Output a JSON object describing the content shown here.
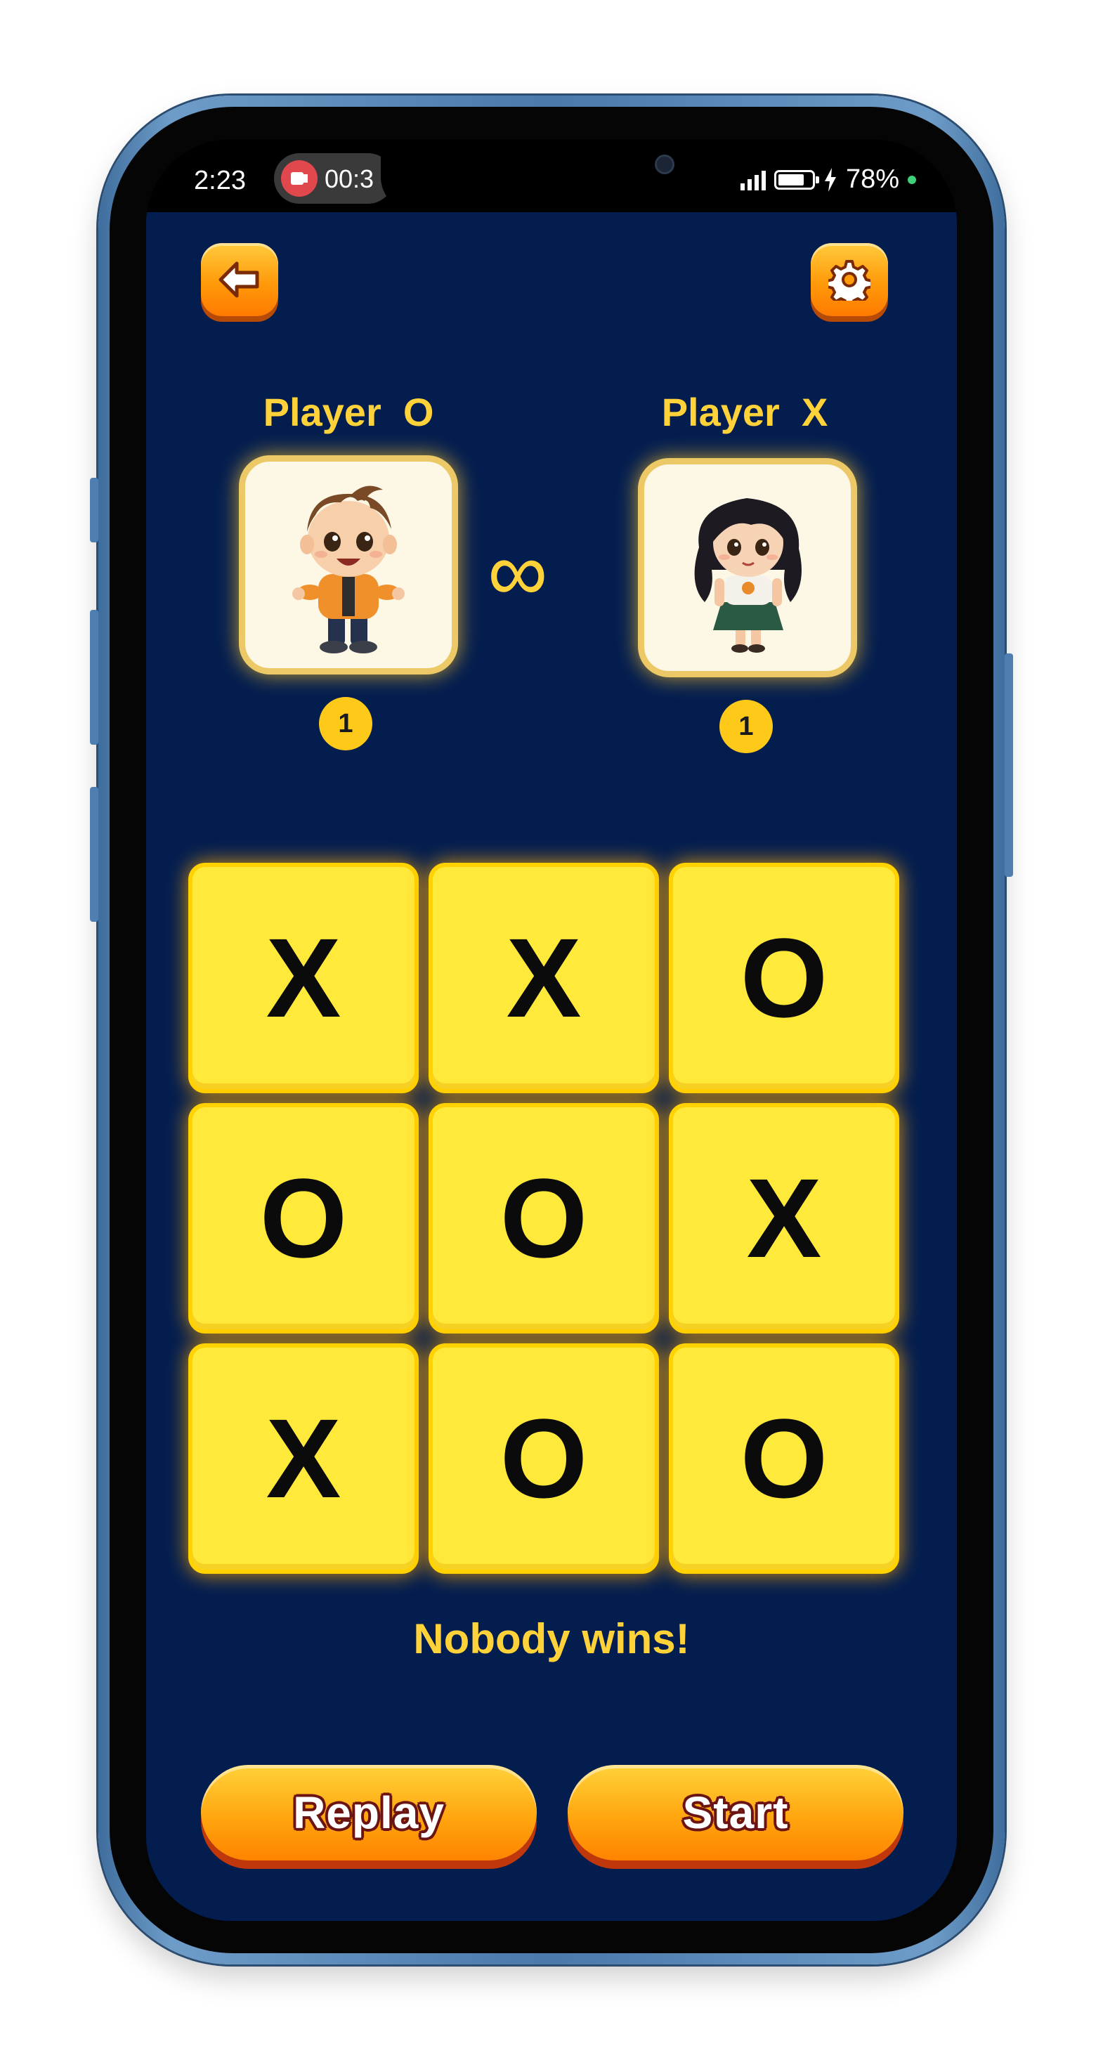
{
  "status_bar": {
    "time": "2:23",
    "recording_time": "00:3",
    "battery": "78%",
    "icons": [
      "record-icon",
      "signal-icon",
      "battery-icon",
      "charging-icon"
    ]
  },
  "header": {
    "back_icon": "back-arrow-icon",
    "settings_icon": "gear-icon"
  },
  "players": {
    "left": {
      "name": "Player  O",
      "score": "1",
      "avatar": "boy-avatar"
    },
    "right": {
      "name": "Player  X",
      "score": "1",
      "avatar": "girl-avatar"
    },
    "versus_symbol": "∞"
  },
  "board": {
    "cells": [
      "X",
      "X",
      "O",
      "O",
      "O",
      "X",
      "X",
      "O",
      "O"
    ]
  },
  "result": "Nobody wins!",
  "buttons": {
    "replay": "Replay",
    "start": "Start"
  },
  "colors": {
    "background": "#031d4f",
    "accent": "#ffd23a",
    "cell": "#ffe93a",
    "button": "#ff9a0a"
  }
}
